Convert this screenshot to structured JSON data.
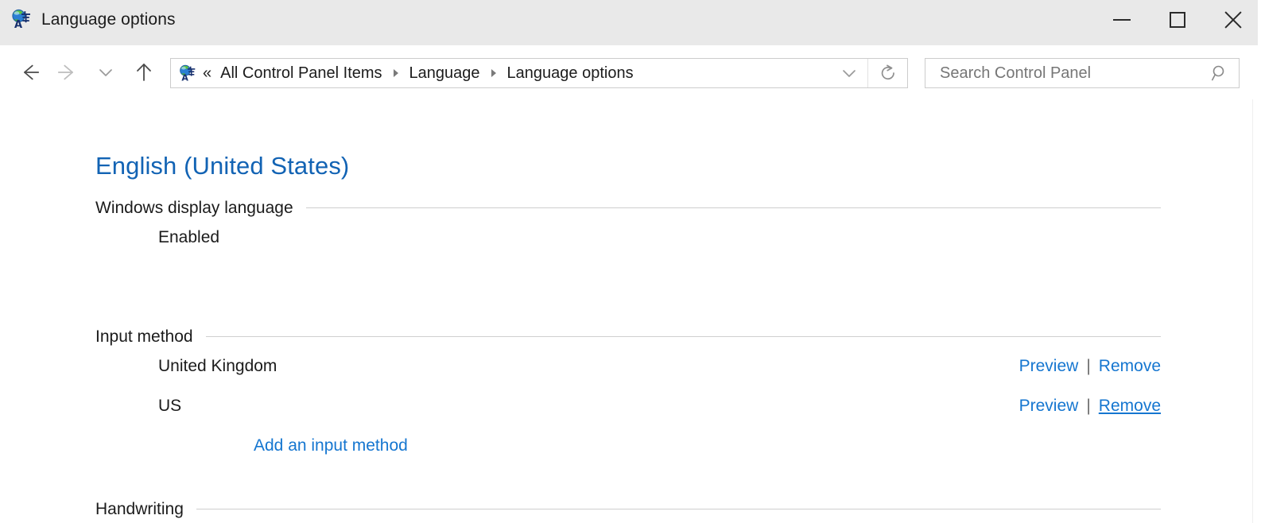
{
  "window": {
    "title": "Language options",
    "icon": "language-globe-icon",
    "controls": {
      "minimize_label": "Minimize",
      "maximize_label": "Maximize",
      "close_label": "Close"
    }
  },
  "navbar": {
    "back_label": "Back",
    "forward_label": "Forward",
    "recent_label": "Recent locations",
    "up_label": "Up one level",
    "address": {
      "icon": "language-globe-icon",
      "overflow_glyph": "«",
      "crumbs": [
        {
          "label": "All Control Panel Items"
        },
        {
          "label": "Language"
        },
        {
          "label": "Language options"
        }
      ],
      "dropdown_label": "Previous locations",
      "refresh_label": "Refresh"
    },
    "search": {
      "placeholder": "Search Control Panel",
      "value": "",
      "icon": "search-icon"
    }
  },
  "main": {
    "page_title": "English (United States)",
    "sections": [
      {
        "id": "windows-display-language",
        "heading": "Windows display language",
        "status": "Enabled"
      },
      {
        "id": "input-method",
        "heading": "Input method",
        "rows": [
          {
            "name": "United Kingdom",
            "preview_label": "Preview",
            "separator": "|",
            "remove_label": "Remove",
            "remove_hovered": false
          },
          {
            "name": "US",
            "preview_label": "Preview",
            "separator": "|",
            "remove_label": "Remove",
            "remove_hovered": true
          }
        ],
        "add_link": "Add an input method"
      },
      {
        "id": "handwriting",
        "heading": "Handwriting"
      }
    ]
  },
  "colors": {
    "accent_link": "#1576d0",
    "page_title": "#1263b4",
    "titlebar_bg": "#e9e9e9",
    "text": "#1b1b1b",
    "rule": "#cfcfcf"
  }
}
